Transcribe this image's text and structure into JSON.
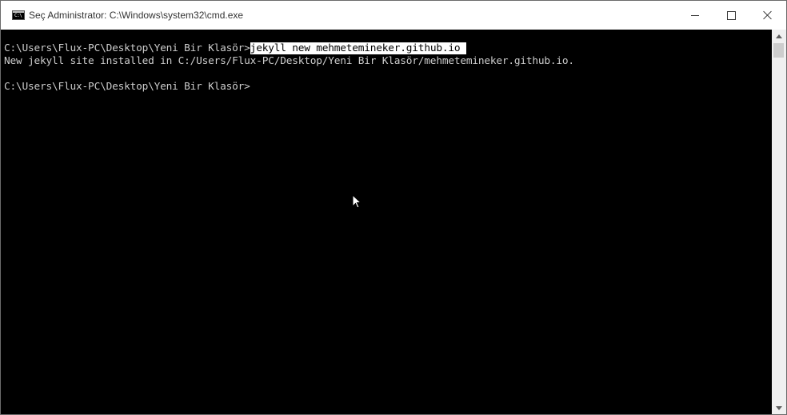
{
  "window": {
    "title": "Seç Administrator: C:\\Windows\\system32\\cmd.exe",
    "app_icon_text": "C:\\"
  },
  "icons": {
    "app": "cmd-icon",
    "minimize": "minimize-icon",
    "maximize": "maximize-icon",
    "close": "close-icon"
  },
  "console": {
    "line1_prompt": "C:\\Users\\Flux-PC\\Desktop\\Yeni Bir Klasör>",
    "line1_command": "jekyll new mehmetemineker.github.io ",
    "line2": "New jekyll site installed in C:/Users/Flux-PC/Desktop/Yeni Bir Klasör/mehmetemineker.github.io.",
    "line3_prompt": "C:\\Users\\Flux-PC\\Desktop\\Yeni Bir Klasör>"
  },
  "colors": {
    "console_bg": "#000000",
    "console_text": "#cccccc",
    "selection_bg": "#ffffff",
    "titlebar_bg": "#ffffff"
  }
}
